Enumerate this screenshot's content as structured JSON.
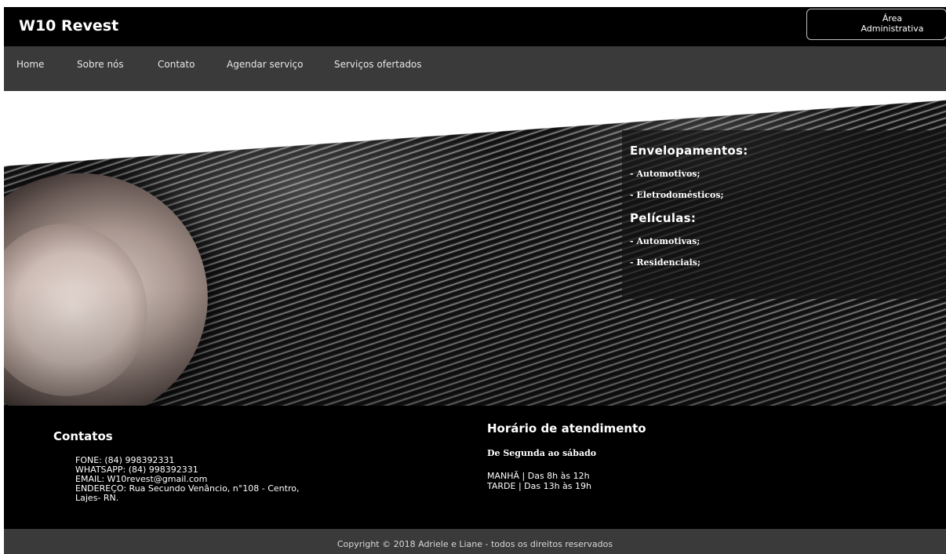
{
  "header": {
    "logo": "W10 Revest",
    "admin_button_line1": "Área",
    "admin_button_line2": "Administrativa"
  },
  "nav": {
    "items": [
      "Home",
      "Sobre nós",
      "Contato",
      "Agendar serviço",
      "Serviços ofertados"
    ]
  },
  "services": {
    "group1_title": "Envelopamentos:",
    "group1_items": [
      "- Automotivos;",
      "- Eletrodomésticos;"
    ],
    "group2_title": "Películas:",
    "group2_items": [
      "- Automotivas;",
      "- Residenciais;"
    ]
  },
  "contacts": {
    "title": "Contatos",
    "lines": [
      "FONE: (84) 998392331",
      "WHATSAPP: (84) 998392331",
      "EMAIL: W10revest@gmail.com",
      "ENDEREÇO: Rua Secundo Venâncio, n°108 - Centro,",
      "Lajes- RN."
    ]
  },
  "hours": {
    "title": "Horário de atendimento",
    "subtitle": "De Segunda ao sábado",
    "lines": [
      "MANHÃ | Das 8h às 12h",
      "TARDE | Das 13h às 19h"
    ]
  },
  "footer": {
    "copyright": "Copyright © 2018 Adriele e Liane - todos os direitos reservados"
  },
  "colors": {
    "header_bg": "#000000",
    "nav_bg": "#3a3a3a",
    "footer_bg": "#000000",
    "copyright_bg": "#3a3a3a"
  }
}
